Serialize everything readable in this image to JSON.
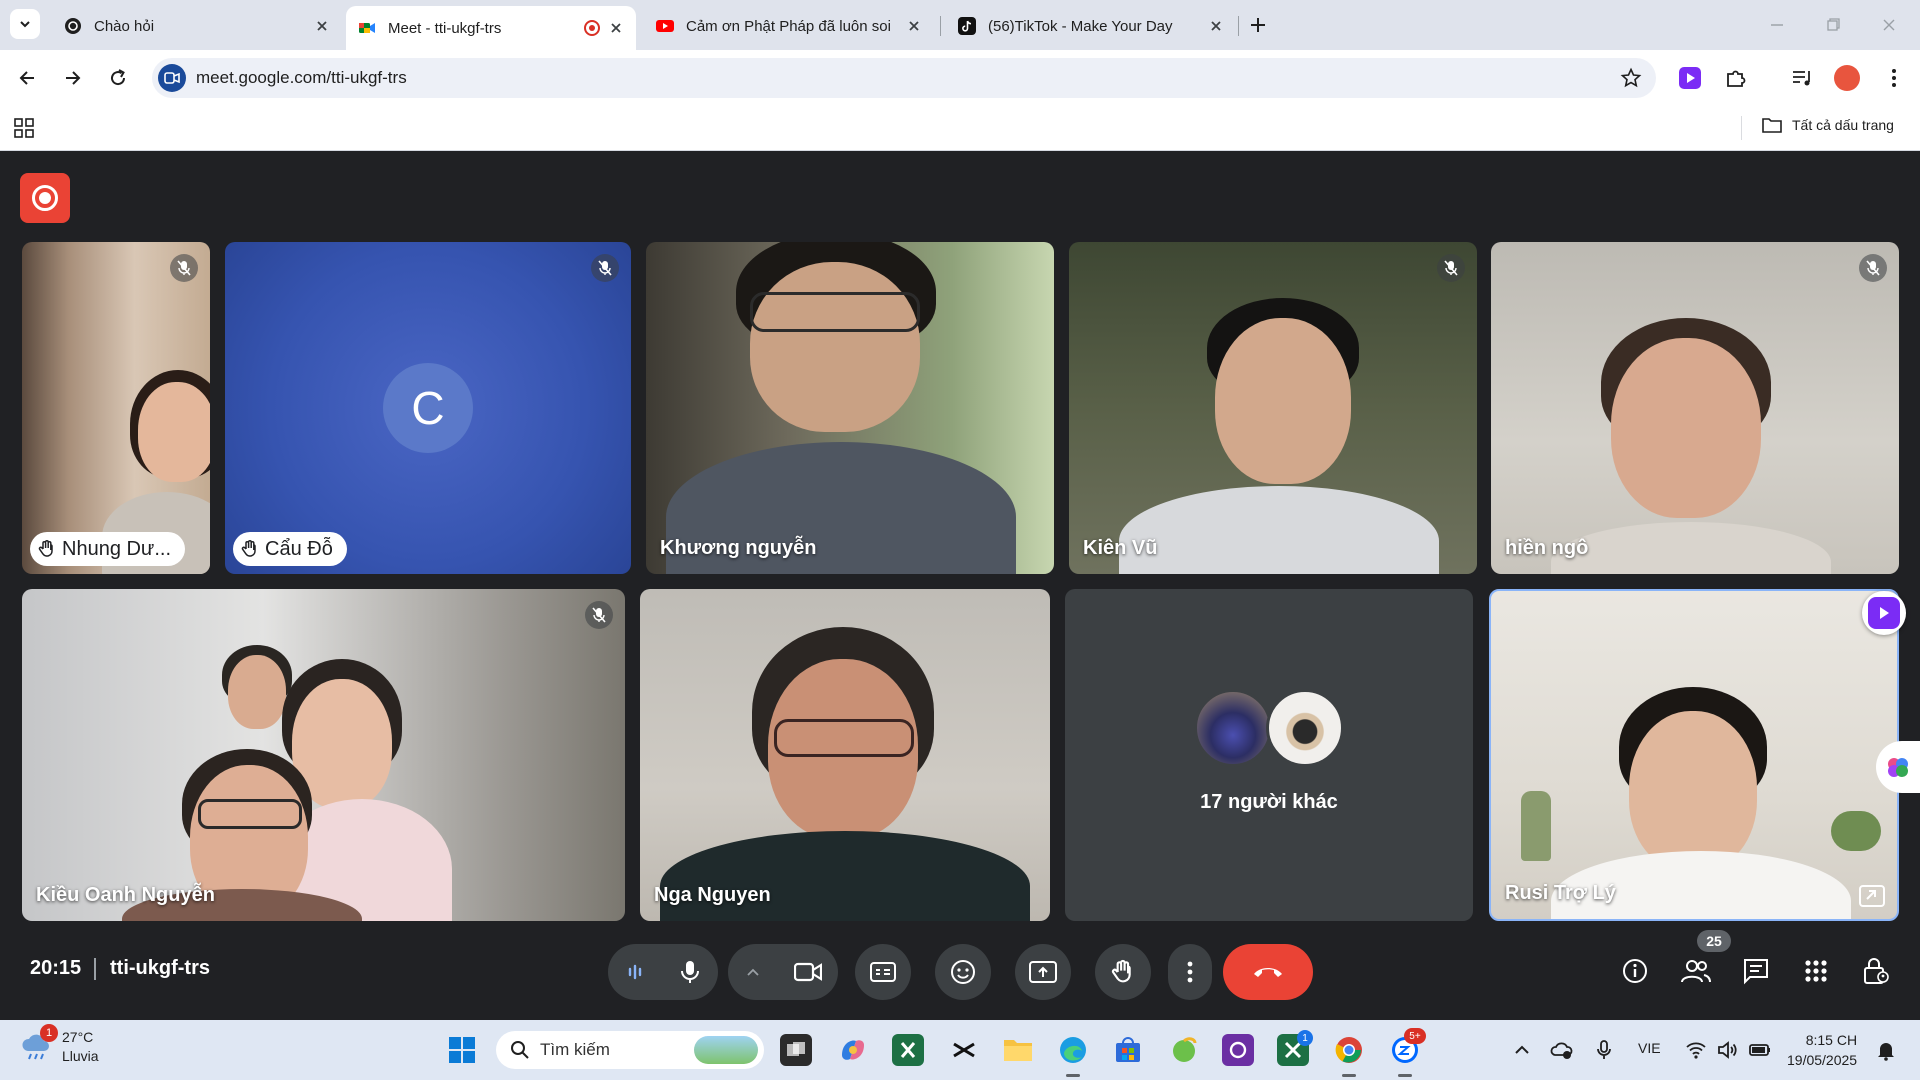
{
  "browser": {
    "tabs": [
      {
        "title": "Chào hỏi",
        "active": false
      },
      {
        "title": "Meet - tti-ukgf-trs",
        "active": true
      },
      {
        "title": "Cảm ơn Phật Pháp đã luôn soi",
        "active": false
      },
      {
        "title": "(56)TikTok - Make Your Day",
        "active": false
      }
    ],
    "url": "meet.google.com/tti-ukgf-trs",
    "bookmarks_folder": "Tất cả dấu trang"
  },
  "meeting": {
    "time": "20:15",
    "code": "tti-ukgf-trs",
    "participants_count": "25",
    "others_label": "17 người khác",
    "tiles": [
      {
        "name": "Nhung Dư...",
        "hand_raised": true,
        "muted": true
      },
      {
        "name": "Cẩu Đỗ",
        "initial": "C",
        "hand_raised": true,
        "muted": true
      },
      {
        "name": "Khương nguyễn",
        "muted": false
      },
      {
        "name": "Kiên Vũ",
        "muted": true
      },
      {
        "name": "hiền ngô",
        "muted": true
      },
      {
        "name": "Kiều Oanh Nguyễn",
        "muted": true
      },
      {
        "name": "Nga Nguyen",
        "muted": false
      },
      {
        "name": "Rusi Trợ Lý",
        "muted": false
      }
    ]
  },
  "taskbar": {
    "weather_temp": "27°C",
    "weather_desc": "Lluvia",
    "weather_badge": "1",
    "search_placeholder": "Tìm kiếm",
    "language": "VIE",
    "time": "8:15 CH",
    "date": "19/05/2025",
    "zalo_badge": "5+",
    "xbox_badge": "1"
  },
  "colors": {
    "meet_bg": "#202124",
    "control_bg": "#3c4043",
    "hangup": "#ea4335",
    "tile_c_bg": "#3f5bb5"
  }
}
